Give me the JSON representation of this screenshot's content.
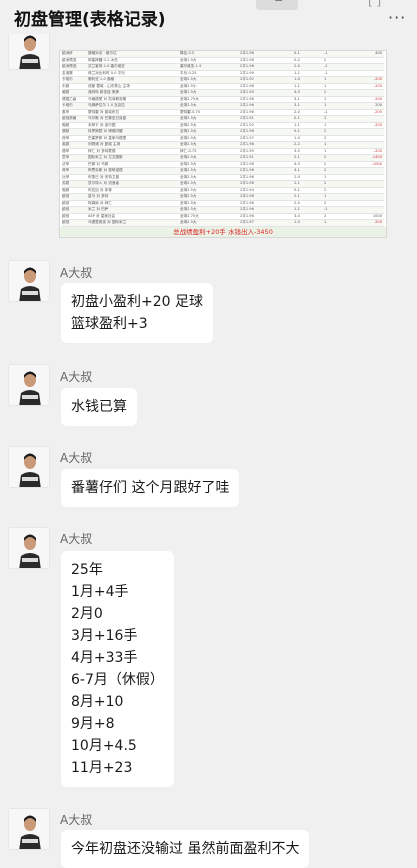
{
  "header": {
    "title": "初盘管理(表格记录)",
    "more_label": "···"
  },
  "image_message": {
    "footer_text": "总战绩盈利+20手   水钱出入-3450",
    "rows": [
      [
        "欧洲杯",
        "挪威对法 · 维尔达",
        "降至-0.5",
        "2平1.96",
        "0-1",
        "-1",
        "400"
      ],
      [
        "欧洲预选",
        "阿塞拜疆 0-2 冰岛",
        "全场1.5大",
        "2平1.96",
        "0-2",
        "2",
        ""
      ],
      [
        "欧洲预选",
        "芬兰客场 2-0 塞尔维亚",
        "塞尔维亚-1.5",
        "2平1.96",
        "2-0",
        "-1",
        ""
      ],
      [
        "友谊赛",
        "荷兰对比利时 0-0 平乐",
        "平乐-0.25",
        "2平1.99",
        "1-1",
        "-1",
        ""
      ],
      [
        "卡塔尔",
        "赛利亚 1-0 澳格",
        "全场2.5大",
        "2平1.92",
        "1-0",
        "1",
        "-200"
      ],
      [
        "中超",
        "成都 蓉城 - 山东泰山 主场",
        "全场2.5小",
        "2平1.96",
        "1-1",
        "1",
        "-200"
      ],
      [
        "威超",
        "弗林特 新圣徒 美美",
        "全场1.5大",
        "2平1.90",
        "4-0",
        "2",
        ""
      ],
      [
        "德国乙级",
        "马格德堡 对 凯泽斯劳滕",
        "全场2.75大",
        "2平1.96",
        "3-1",
        "1",
        "-200"
      ],
      [
        "卡塔尔",
        "乌姆萨拉尔 1-0 瓦克拉",
        "全场2.5大",
        "2平1.96",
        "3-1",
        "1",
        "200"
      ],
      [
        "墨甲",
        "蒙特雷 对 普埃布拉",
        "蒙特雷-0.75",
        "2平1.96",
        "2-0",
        "-1",
        "-200"
      ],
      [
        "欧冠资格",
        "马尔默 对 巴黎圣日耳曼",
        "全场2.5大",
        "2平1.91",
        "0-1",
        "2",
        ""
      ],
      [
        "葡超",
        "本菲卡 对 波尔图",
        "全场2.5大",
        "2平1.92",
        "1-1",
        "1",
        "-200"
      ],
      [
        "挪超",
        "特罗姆瑟 对 博德闪耀",
        "全场2.5大",
        "2平1.96",
        "0-1",
        "2",
        ""
      ],
      [
        "西甲",
        "巴塞罗那 对 皇家马德里",
        "全场2.5大",
        "2平1.97",
        "1-0",
        "2",
        ""
      ],
      [
        "英超",
        "利物浦 对 曼城 主场",
        "全场2.5大",
        "2平1.96",
        "2-2",
        "1",
        ""
      ],
      [
        "德甲",
        "拜仁 对 多特蒙德",
        "拜仁-0.75",
        "2平1.95",
        "3-0",
        "1",
        "-200"
      ],
      [
        "意甲",
        "国际米兰 对 尤文图斯",
        "全场2.5大",
        "2平1.91",
        "2-1",
        "2",
        "-1400"
      ],
      [
        "法甲",
        "巴黎 对 马赛",
        "全场2.5大",
        "2平1.96",
        "4-0",
        "2",
        "-1000"
      ],
      [
        "荷甲",
        "阿贾克斯 对 费耶诺德",
        "全场2.5大",
        "2平1.96",
        "3-1",
        "2",
        ""
      ],
      [
        "比甲",
        "布鲁日 对 安特卫普",
        "全场2.5大",
        "2平1.96",
        "2-0",
        "1",
        ""
      ],
      [
        "苏超",
        "凯尔特人 对 流浪者",
        "全场2.5大",
        "2平1.96",
        "2-1",
        "2",
        ""
      ],
      [
        "葡超",
        "布拉加 对 体育",
        "全场2.5大",
        "2平1.94",
        "0-1",
        "2",
        ""
      ],
      [
        "欧冠",
        "皇马 对 多特",
        "全场2.5大",
        "2平1.96",
        "2-1",
        "1",
        ""
      ],
      [
        "欧冠",
        "阿森纳 对 拜仁",
        "全场2.5大",
        "2平1.96",
        "2-0",
        "2",
        ""
      ],
      [
        "欧冠",
        "米兰 对 巴萨",
        "全场2.5大",
        "2平1.96",
        "1-1",
        "-1",
        ""
      ],
      [
        "欧冠",
        "AEP 对 皇家社会",
        "全场2.75大",
        "2平1.96",
        "3-0",
        "2",
        "1000"
      ],
      [
        "欧冠",
        "马德里竞技 对 国际米兰",
        "全场2.5大",
        "2平1.97",
        "1-0",
        "1",
        "-200"
      ],
      [
        "欧冠",
        "切尔西 对 巴黎",
        "全场2.5大",
        "2平1.92",
        "0-2",
        "2",
        ""
      ],
      [
        "欧冠",
        "曼联 对 利物浦",
        "全场2.5大",
        "2平1.96",
        "2-2",
        "1",
        "-200"
      ],
      [
        "英超",
        "热刺 对 纽卡",
        "全场2.5大",
        "2平1.95",
        "1-1",
        "1",
        ""
      ],
      [
        "英超",
        "阿斯顿维拉 对 布莱顿",
        "全场2.5大",
        "2平1.96",
        "2-1",
        "1",
        "-200"
      ],
      [
        "英冠",
        "利兹联 对 伯恩利",
        "全场2.5大",
        "2平1.96",
        "1-0",
        "1",
        "-200"
      ],
      [
        "西甲",
        "皇家贝蒂斯 对 塞维利亚",
        "全场2.5大",
        "2平1.96",
        "2-1",
        "2",
        ""
      ],
      [
        "西甲",
        "瓦伦西亚 对 比利亚雷亚尔",
        "全场2.5大",
        "2平1.96",
        "2-1",
        "2",
        ""
      ]
    ]
  },
  "messages": [
    {
      "sender": "A大叔",
      "lines": [
        "初盘小盈利+20 足球",
        "篮球盈利+3"
      ]
    },
    {
      "sender": "A大叔",
      "lines": [
        "水钱已算"
      ]
    },
    {
      "sender": "A大叔",
      "lines": [
        "番薯仔们 这个月跟好了哇"
      ]
    },
    {
      "sender": "A大叔",
      "lines": [
        "25年",
        "1月+4手",
        "2月0",
        "3月+16手",
        "4月+33手",
        "6-7月（休假）",
        "8月+10",
        "9月+8",
        "10月+4.5",
        "11月+23"
      ]
    },
    {
      "sender": "A大叔",
      "lines": [
        "今年初盘还没输过 虽然前面盈利不大"
      ]
    }
  ]
}
